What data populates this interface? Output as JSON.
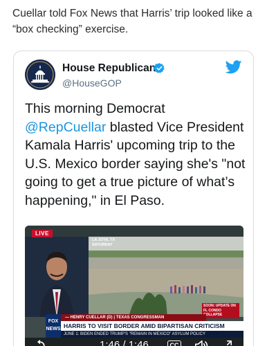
{
  "article": {
    "paragraph": "Cuellar told Fox News that Harris’ trip looked like a “box checking” exercise."
  },
  "tweet": {
    "account_name": "House Republicans",
    "handle": "@HouseGOP",
    "text_before": "This morning Democrat ",
    "mention": "@RepCuellar",
    "text_after": " blasted Vice President Kamala Harris' upcoming trip to the U.S. Mexico border saying she's \"not going to get a true picture of what’s happening,\" in El Paso."
  },
  "video": {
    "live_label": "LIVE",
    "location": "LA JOYA, TX SATURDAY",
    "alert": "SOON: UPDATE ON FL CONDO COLLAPSE",
    "name_strap": "— HENRY CUELLAR (D) | TEXAS CONGRESSMAN",
    "headline": "HARRIS TO VISIT BORDER AMID BIPARTISAN CRITICISM",
    "ticker": "JUNE 1: BIDEN ENDED TRUMP'S \"REMAIN IN MEXICO\" ASYLUM POLICY",
    "network": "FOX NEWS",
    "time": "1:46 / 1:46",
    "cc_label": "CC"
  },
  "colors": {
    "link": "#1b95e0",
    "twitter_blue": "#1da1f2",
    "live_red": "#c8102e"
  },
  "icons": [
    "verified-icon",
    "twitter-bird-icon",
    "replay-icon",
    "volume-icon",
    "expand-icon"
  ]
}
